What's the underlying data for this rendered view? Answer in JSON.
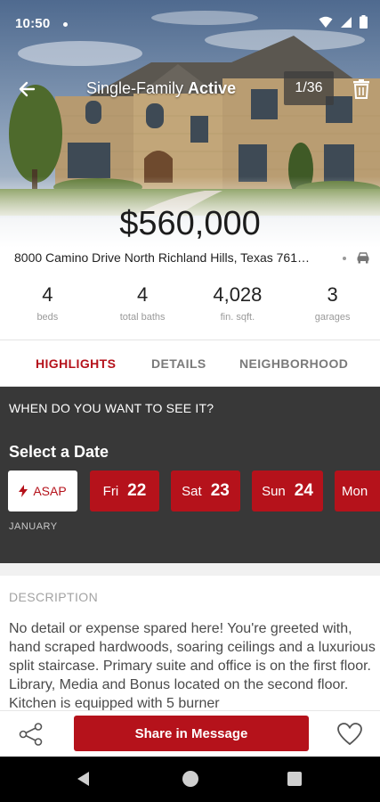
{
  "status_bar": {
    "time": "10:50"
  },
  "header": {
    "type_label": "Single-Family",
    "status_label": "Active",
    "photo_counter": "1/36"
  },
  "listing": {
    "price": "$560,000",
    "address": "8000 Camino Drive North Richland Hills, Texas 761…"
  },
  "stats": [
    {
      "value": "4",
      "label": "beds"
    },
    {
      "value": "4",
      "label": "total baths"
    },
    {
      "value": "4,028",
      "label": "fin. sqft."
    },
    {
      "value": "3",
      "label": "garages"
    }
  ],
  "tabs": [
    {
      "label": "HIGHLIGHTS",
      "active": true
    },
    {
      "label": "DETAILS",
      "active": false
    },
    {
      "label": "NEIGHBORHOOD",
      "active": false
    }
  ],
  "schedule": {
    "question": "WHEN DO YOU WANT TO SEE IT?",
    "title": "Select a Date",
    "asap_label": "ASAP",
    "dates": [
      {
        "dow": "Fri",
        "day": "22"
      },
      {
        "dow": "Sat",
        "day": "23"
      },
      {
        "dow": "Sun",
        "day": "24"
      },
      {
        "dow": "Mon",
        "day": ""
      }
    ],
    "month": "JANUARY"
  },
  "description": {
    "heading": "DESCRIPTION",
    "text": "No detail or expense spared here! You're greeted with, hand scraped hardwoods, soaring ceilings and a luxurious split staircase. Primary suite and office is on the first floor. Library, Media and Bonus located on the second floor. Kitchen is equipped with 5 burner"
  },
  "actions": {
    "share_message_label": "Share in Message"
  },
  "colors": {
    "accent": "#b5121b",
    "schedule_bg": "#383838",
    "nav_bg": "#000000"
  },
  "icons": [
    "back-arrow-icon",
    "trash-icon",
    "car-icon",
    "bolt-icon",
    "share-icon",
    "heart-icon",
    "wifi-icon",
    "signal-icon",
    "battery-icon"
  ]
}
